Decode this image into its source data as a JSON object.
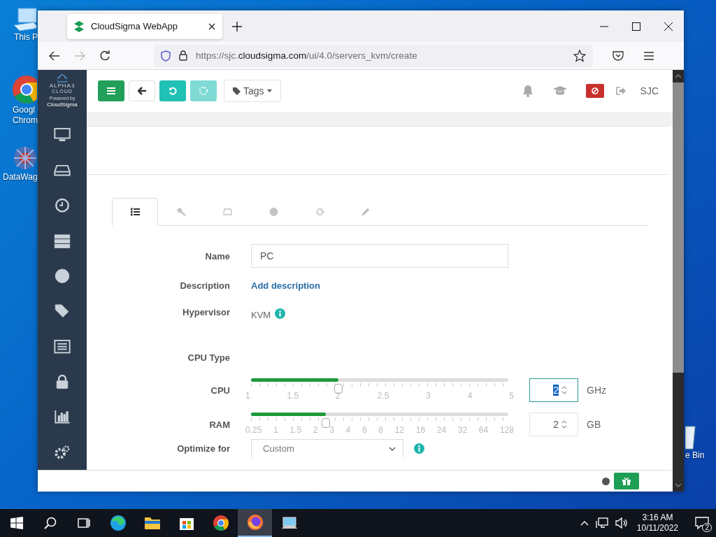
{
  "desktop": {
    "icons": [
      {
        "kind": "computer",
        "lines": [
          "This P"
        ]
      },
      {
        "kind": "chrome",
        "lines": [
          "Googl",
          "Chrom"
        ]
      },
      {
        "kind": "network",
        "lines": [
          "DataWag"
        ]
      },
      {
        "kind": "recycle",
        "lines": [
          "e Bin"
        ]
      }
    ]
  },
  "browser": {
    "tab_title": "CloudSigma WebApp",
    "url": {
      "prefix": "https://sjc.",
      "domain": "cloudsigma.com",
      "path": "/ui/4.0/servers_kvm/create"
    }
  },
  "app": {
    "logo": {
      "name": "ALPHA3",
      "sub": "CLOUD",
      "powered": "Powered by",
      "brand": "CloudSigma"
    },
    "toolbar": {
      "tags": "Tags",
      "region": "SJC"
    },
    "tabs": [
      {
        "selected": true
      },
      {
        "selected": false
      },
      {
        "selected": false
      },
      {
        "selected": false
      },
      {
        "selected": false
      },
      {
        "selected": false
      }
    ],
    "form": {
      "name": {
        "label": "Name",
        "value": "PC"
      },
      "description": {
        "label": "Description",
        "link": "Add description"
      },
      "hypervisor": {
        "label": "Hypervisor",
        "value": "KVM"
      },
      "cpu_type": {
        "label": "CPU Type"
      },
      "cpu": {
        "label": "CPU",
        "level": 0.34,
        "ticks": [
          "1",
          "1.5",
          "2",
          "2.5",
          "3",
          "4",
          "5"
        ],
        "value": "2",
        "unit": "GHz",
        "focused": true
      },
      "ram": {
        "label": "RAM",
        "level": 0.29,
        "ticks": [
          "0.25",
          "1",
          "1.5",
          "2",
          "3",
          "4",
          "6",
          "8",
          "12",
          "16",
          "24",
          "32",
          "64",
          "128"
        ],
        "value": "2",
        "unit": "GB",
        "focused": false
      },
      "optimize": {
        "label": "Optimize for",
        "value": "Custom"
      }
    }
  },
  "taskbar": {
    "apps": [
      {
        "selected": false
      },
      {
        "selected": false
      },
      {
        "selected": false
      },
      {
        "selected": false
      },
      {
        "selected": true
      },
      {
        "selected": false
      }
    ],
    "time": "3:16 AM",
    "date": "10/11/2022",
    "notifications": "2"
  }
}
